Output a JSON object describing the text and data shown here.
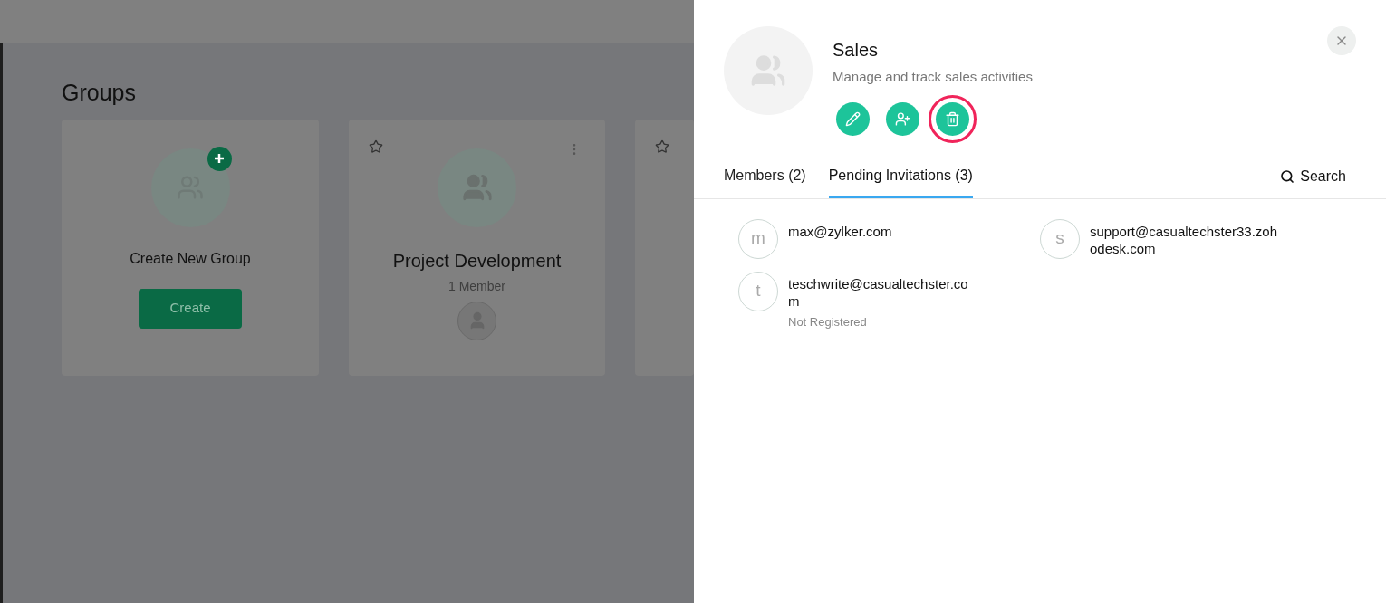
{
  "page": {
    "title": "Groups"
  },
  "create_card": {
    "title": "Create New Group",
    "button": "Create"
  },
  "group_cards": [
    {
      "name": "Project Development",
      "members": "1 Member",
      "starred": false
    },
    {
      "starred": false
    }
  ],
  "panel": {
    "title": "Sales",
    "description": "Manage and track sales activities",
    "actions": [
      {
        "kind": "edit",
        "highlighted": false
      },
      {
        "kind": "add-member",
        "highlighted": false
      },
      {
        "kind": "delete",
        "highlighted": true
      }
    ],
    "tabs": [
      {
        "label": "Members (2)",
        "selected": false
      },
      {
        "label": "Pending Invitations (3)",
        "selected": true
      }
    ],
    "search": "Search",
    "invitations": [
      {
        "initial": "m",
        "email": "max@zylker.com"
      },
      {
        "initial": "s",
        "email": "support@casualtechster33.zohodesk.com"
      },
      {
        "initial": "t",
        "email": "teschwrite@casualtechster.com",
        "status": "Not Registered"
      }
    ]
  }
}
